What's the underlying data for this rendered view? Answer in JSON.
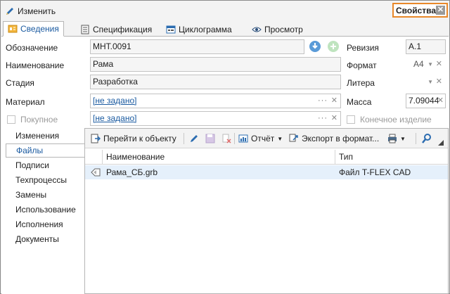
{
  "header": {
    "edit_label": "Изменить",
    "properties_label": "Свойства",
    "close_glyph": "✕"
  },
  "tabs": [
    {
      "label": "Сведения",
      "icon": "info-card-icon",
      "active": true
    },
    {
      "label": "Спецификация",
      "icon": "document-icon"
    },
    {
      "label": "Циклограмма",
      "icon": "calendar-icon"
    },
    {
      "label": "Просмотр",
      "icon": "eye-icon"
    }
  ],
  "form": {
    "designation_label": "Обозначение",
    "designation_value": "МНТ.0091",
    "name_label": "Наименование",
    "name_value": "Рама",
    "stage_label": "Стадия",
    "stage_value": "Разработка",
    "material_label": "Материал",
    "material_value": "[не задано]",
    "purchased_label": "Покупное",
    "purchased_value": "[не задано]",
    "revision_label": "Ревизия",
    "revision_value": "А.1",
    "format_label": "Формат",
    "format_value": "А4",
    "litera_label": "Литера",
    "litera_value": "",
    "mass_label": "Масса",
    "mass_value": "7.09044",
    "final_product_label": "Конечное изделие",
    "ellipsis": "···",
    "clear_glyph": "✕",
    "dropdown_glyph": "▼"
  },
  "nav": {
    "items": [
      "Изменения",
      "Файлы",
      "Подписи",
      "Техпроцессы",
      "Замены",
      "Использование",
      "Исполнения",
      "Документы"
    ],
    "active_index": 1
  },
  "toolbar": {
    "goto_label": "Перейти к объекту",
    "report_label": "Отчёт",
    "export_label": "Экспорт в формат...",
    "caret": "▼"
  },
  "grid": {
    "columns": [
      "Наименование",
      "Тип"
    ],
    "rows": [
      {
        "name": "Рама_СБ.grb",
        "type": "Файл T-FLEX CAD"
      }
    ]
  },
  "colors": {
    "accent": "#1a5aa0",
    "highlight_border": "#e8882a",
    "selected_row": "#e5f0fb"
  }
}
